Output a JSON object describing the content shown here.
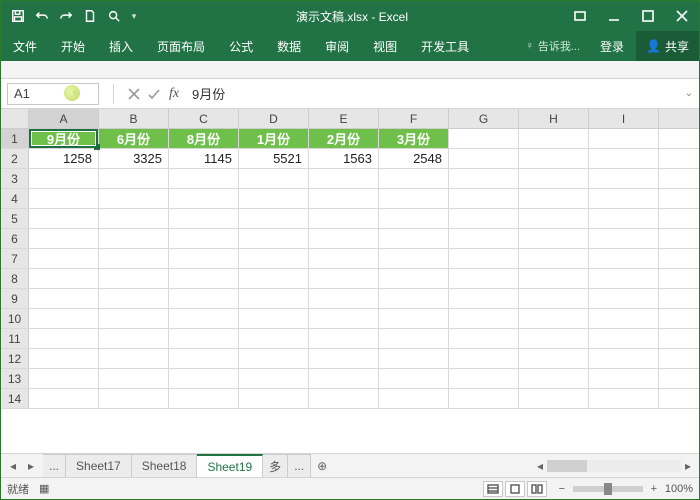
{
  "title": "演示文稿.xlsx - Excel",
  "ribbon": {
    "tabs": [
      "文件",
      "开始",
      "插入",
      "页面布局",
      "公式",
      "数据",
      "审阅",
      "视图",
      "开发工具"
    ],
    "tell": "告诉我...",
    "signin": "登录",
    "share": "共享"
  },
  "namebox": {
    "value": "A1"
  },
  "formula": {
    "value": "9月份"
  },
  "columns": [
    "A",
    "B",
    "C",
    "D",
    "E",
    "F",
    "G",
    "H",
    "I"
  ],
  "rows": [
    1,
    2,
    3,
    4,
    5,
    6,
    7,
    8,
    9,
    10,
    11,
    12,
    13,
    14
  ],
  "activeCell": "A1",
  "header_row": [
    "9月份",
    "6月份",
    "8月份",
    "1月份",
    "2月份",
    "3月份"
  ],
  "data_row": [
    "1258",
    "3325",
    "1145",
    "5521",
    "1563",
    "2548"
  ],
  "chart_data": {
    "type": "table",
    "categories": [
      "9月份",
      "6月份",
      "8月份",
      "1月份",
      "2月份",
      "3月份"
    ],
    "values": [
      1258,
      3325,
      1145,
      5521,
      1563,
      2548
    ]
  },
  "sheets": {
    "list": [
      "Sheet17",
      "Sheet18",
      "Sheet19"
    ],
    "active": "Sheet19",
    "more_left": "...",
    "more_right": "多"
  },
  "status": {
    "ready": "就绪",
    "zoom_label": "100%"
  },
  "colors": {
    "brand": "#217346",
    "headerFill": "#6fbf4b"
  }
}
